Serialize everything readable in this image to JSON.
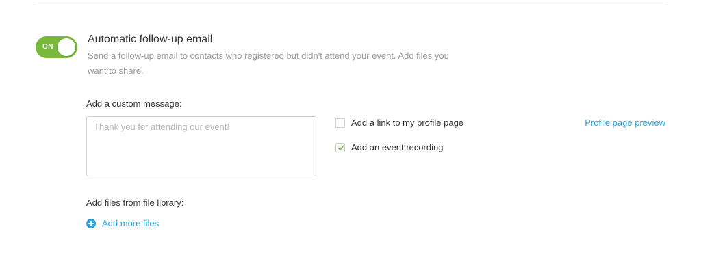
{
  "followup": {
    "toggle_state": "ON",
    "title": "Automatic follow-up email",
    "description": "Send a follow-up email to contacts who registered but didn't attend your event. Add files you want to share."
  },
  "message": {
    "label": "Add a custom message:",
    "placeholder": "Thank you for attending our event!",
    "value": ""
  },
  "options": {
    "profile_link": {
      "label": "Add a link to my profile page",
      "checked": false
    },
    "event_recording": {
      "label": "Add an event recording",
      "checked": true
    },
    "preview_link": "Profile page preview"
  },
  "files": {
    "label": "Add files from file library:",
    "add_label": "Add more files"
  },
  "colors": {
    "toggle_on": "#78b83a",
    "link": "#2ea3d8",
    "check": "#78b83a"
  },
  "icons": {
    "add_files": "plus-circle-icon",
    "checked": "checkmark-icon"
  }
}
